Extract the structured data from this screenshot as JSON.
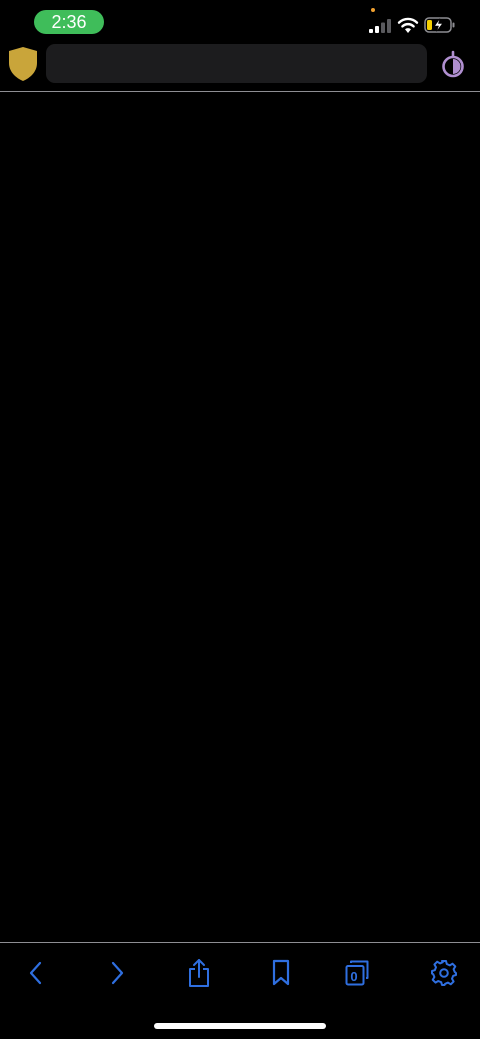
{
  "status_bar": {
    "time": "2:36",
    "time_pill_color": "#3fbd5a",
    "privacy_dot_color": "#f0a030",
    "icons": [
      "cellular-signal-icon",
      "wifi-icon",
      "battery-charging-icon"
    ]
  },
  "toolbar": {
    "shield_icon": "shield-icon",
    "shield_color": "#c9a53a",
    "address_bar": {
      "value": "",
      "placeholder": ""
    },
    "onion_icon": "onion-icon",
    "onion_color": "#b08fd0"
  },
  "bottom_toolbar": {
    "accent_color": "#2f6fe0",
    "buttons": [
      {
        "name": "back",
        "icon": "chevron-left-icon"
      },
      {
        "name": "forward",
        "icon": "chevron-right-icon"
      },
      {
        "name": "share",
        "icon": "share-icon"
      },
      {
        "name": "bookmarks",
        "icon": "bookmark-icon"
      },
      {
        "name": "tabs",
        "icon": "tabs-icon"
      },
      {
        "name": "settings",
        "icon": "gear-icon"
      }
    ],
    "tabs_count": "0"
  }
}
